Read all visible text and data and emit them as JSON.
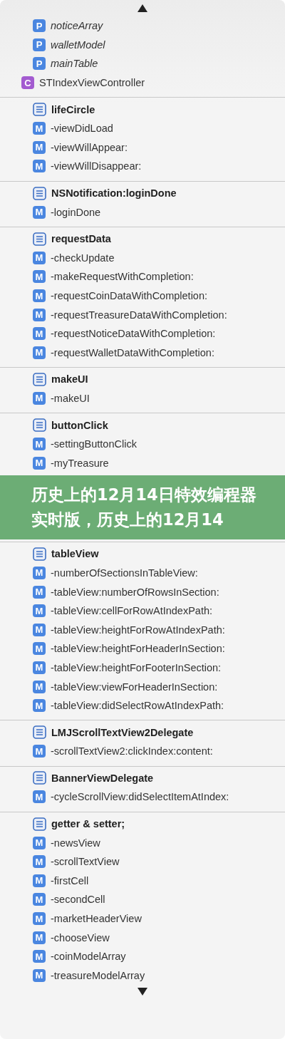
{
  "top_items": [
    {
      "kind": "property",
      "badge": "P",
      "label": "noticeArray"
    },
    {
      "kind": "property",
      "badge": "P",
      "label": "walletModel"
    },
    {
      "kind": "property",
      "badge": "P",
      "label": "mainTable"
    },
    {
      "kind": "class",
      "badge": "C",
      "label": "STIndexViewController"
    }
  ],
  "sections": [
    {
      "title": "lifeCircle",
      "methods": [
        {
          "badge": "M",
          "label": "-viewDidLoad"
        },
        {
          "badge": "M",
          "label": "-viewWillAppear:"
        },
        {
          "badge": "M",
          "label": "-viewWillDisappear:"
        }
      ]
    },
    {
      "title": "NSNotification:loginDone",
      "methods": [
        {
          "badge": "M",
          "label": "-loginDone"
        }
      ]
    },
    {
      "title": "requestData",
      "methods": [
        {
          "badge": "M",
          "label": "-checkUpdate"
        },
        {
          "badge": "M",
          "label": "-makeRequestWithCompletion:"
        },
        {
          "badge": "M",
          "label": "-requestCoinDataWithCompletion:"
        },
        {
          "badge": "M",
          "label": "-requestTreasureDataWithCompletion:"
        },
        {
          "badge": "M",
          "label": "-requestNoticeDataWithCompletion:"
        },
        {
          "badge": "M",
          "label": "-requestWalletDataWithCompletion:"
        }
      ]
    },
    {
      "title": "makeUI",
      "methods": [
        {
          "badge": "M",
          "label": "-makeUI"
        }
      ]
    },
    {
      "title": "buttonClick",
      "methods": [
        {
          "badge": "M",
          "label": "-settingButtonClick"
        },
        {
          "badge": "M",
          "label": "-myTreasure"
        }
      ]
    }
  ],
  "banner": {
    "text": "历史上的12月14日特效编程器实时版，历史上的12月14"
  },
  "sections_below": [
    {
      "title": "tableView",
      "methods": [
        {
          "badge": "M",
          "label": "-numberOfSectionsInTableView:"
        },
        {
          "badge": "M",
          "label": "-tableView:numberOfRowsInSection:"
        },
        {
          "badge": "M",
          "label": "-tableView:cellForRowAtIndexPath:"
        },
        {
          "badge": "M",
          "label": "-tableView:heightForRowAtIndexPath:"
        },
        {
          "badge": "M",
          "label": "-tableView:heightForHeaderInSection:"
        },
        {
          "badge": "M",
          "label": "-tableView:heightForFooterInSection:"
        },
        {
          "badge": "M",
          "label": "-tableView:viewForHeaderInSection:"
        },
        {
          "badge": "M",
          "label": "-tableView:didSelectRowAtIndexPath:"
        }
      ]
    },
    {
      "title": "LMJScrollTextView2Delegate",
      "methods": [
        {
          "badge": "M",
          "label": "-scrollTextView2:clickIndex:content:"
        }
      ]
    },
    {
      "title": "BannerViewDelegate",
      "methods": [
        {
          "badge": "M",
          "label": "-cycleScrollView:didSelectItemAtIndex:"
        }
      ]
    },
    {
      "title": "getter & setter;",
      "methods": [
        {
          "badge": "M",
          "label": "-newsView"
        },
        {
          "badge": "M",
          "label": "-scrollTextView"
        },
        {
          "badge": "M",
          "label": "-firstCell"
        },
        {
          "badge": "M",
          "label": "-secondCell"
        },
        {
          "badge": "M",
          "label": "-marketHeaderView"
        },
        {
          "badge": "M",
          "label": "-chooseView"
        },
        {
          "badge": "M",
          "label": "-coinModelArray"
        },
        {
          "badge": "M",
          "label": "-treasureModelArray"
        }
      ]
    }
  ]
}
